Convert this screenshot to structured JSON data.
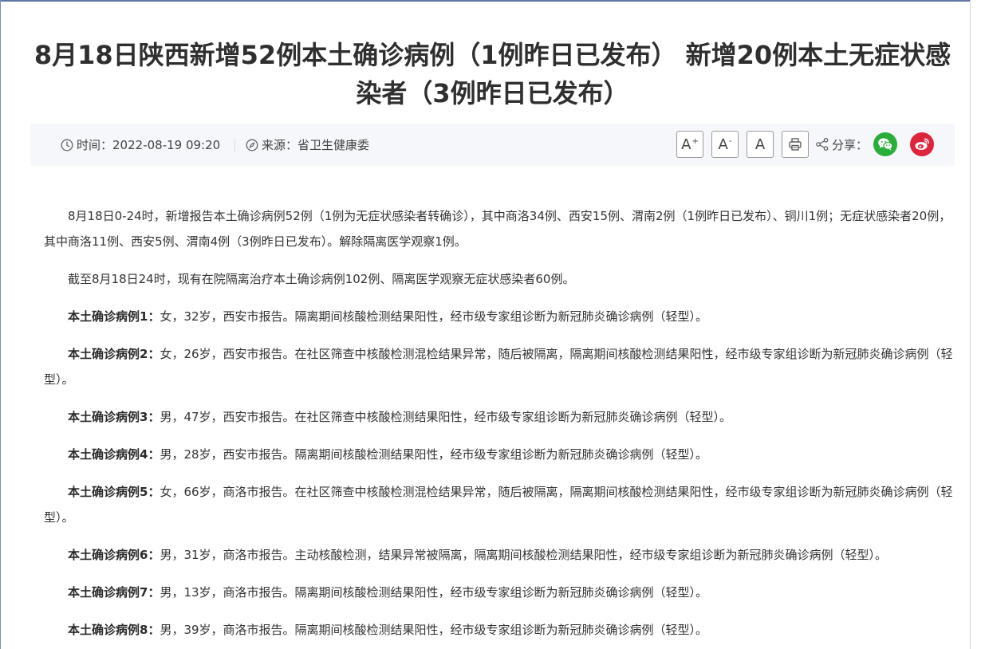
{
  "article": {
    "title": "8月18日陕西新增52例本土确诊病例（1例昨日已发布） 新增20例本土无症状感染者（3例昨日已发布）",
    "meta": {
      "time_label": "时间：",
      "time_value": "2022-08-19 09:20",
      "source_label": "来源：",
      "source_value": "省卫生健康委"
    },
    "tools": {
      "font_increase": "A",
      "font_increase_mark": "+",
      "font_decrease": "A",
      "font_decrease_mark": "-",
      "font_default": "A",
      "share_label": "分享："
    },
    "paragraphs": [
      {
        "lead": "",
        "text": "8月18日0-24时，新增报告本土确诊病例52例（1例为无症状感染者转确诊），其中商洛34例、西安15例、渭南2例（1例昨日已发布）、铜川1例；无症状感染者20例，其中商洛11例、西安5例、渭南4例（3例昨日已发布）。解除隔离医学观察1例。"
      },
      {
        "lead": "",
        "text": "截至8月18日24时，现有在院隔离治疗本土确诊病例102例、隔离医学观察无症状感染者60例。"
      },
      {
        "lead": "本土确诊病例1：",
        "text": "女，32岁，西安市报告。隔离期间核酸检测结果阳性，经市级专家组诊断为新冠肺炎确诊病例（轻型）。"
      },
      {
        "lead": "本土确诊病例2：",
        "text": "女，26岁，西安市报告。在社区筛查中核酸检测混检结果异常，随后被隔离，隔离期间核酸检测结果阳性，经市级专家组诊断为新冠肺炎确诊病例（轻型）。"
      },
      {
        "lead": "本土确诊病例3：",
        "text": "男，47岁，西安市报告。在社区筛查中核酸检测结果阳性，经市级专家组诊断为新冠肺炎确诊病例（轻型）。"
      },
      {
        "lead": "本土确诊病例4：",
        "text": "男，28岁，西安市报告。隔离期间核酸检测结果阳性，经市级专家组诊断为新冠肺炎确诊病例（轻型）。"
      },
      {
        "lead": "本土确诊病例5：",
        "text": "女，66岁，商洛市报告。在社区筛查中核酸检测混检结果异常，随后被隔离，隔离期间核酸检测结果阳性，经市级专家组诊断为新冠肺炎确诊病例（轻型）。"
      },
      {
        "lead": "本土确诊病例6：",
        "text": "男，31岁，商洛市报告。主动核酸检测，结果异常被隔离，隔离期间核酸检测结果阳性，经市级专家组诊断为新冠肺炎确诊病例（轻型）。"
      },
      {
        "lead": "本土确诊病例7：",
        "text": "男，13岁，商洛市报告。隔离期间核酸检测结果阳性，经市级专家组诊断为新冠肺炎确诊病例（轻型）。"
      },
      {
        "lead": "本土确诊病例8：",
        "text": "男，39岁，商洛市报告。隔离期间核酸检测结果阳性，经市级专家组诊断为新冠肺炎确诊病例（轻型）。"
      }
    ]
  },
  "colors": {
    "wechat": "#2aae3a",
    "weibo": "#e0243b",
    "meta_bar": "#f6f7fb",
    "frame": "#5c74a6"
  },
  "icons": [
    "clock-icon",
    "compass-icon",
    "printer-icon",
    "share-icon",
    "wechat-icon",
    "weibo-icon"
  ]
}
